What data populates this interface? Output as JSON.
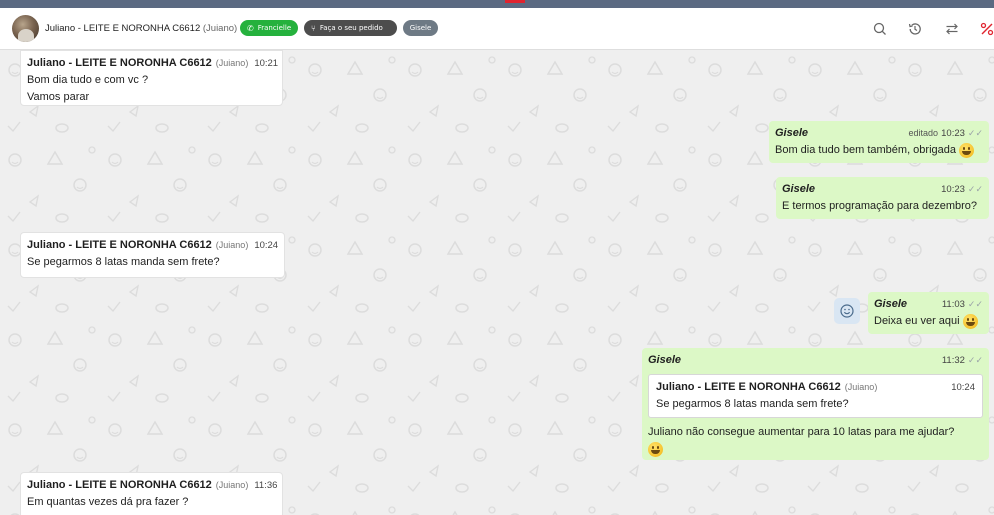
{
  "header": {
    "contact_name": "Juliano - LEITE E NORONHA C6612",
    "contact_alias": "(Juiano)",
    "chip_whatsapp": "Francielle",
    "chip_order": "Faça o seu pedido",
    "chip_agent": "Gisele",
    "icons": [
      "search-icon",
      "history-icon",
      "transfer-icon",
      "percent-icon"
    ]
  },
  "messages": [
    {
      "sender": "Juliano - LEITE E NORONHA C6612",
      "alias": "(Juiano)",
      "time": "10:21",
      "lines": [
        "Bom dia tudo e com vc ?",
        "Vamos parar"
      ]
    },
    {
      "sender": "Gisele",
      "edited": "editado",
      "time": "10:23",
      "text": "Bom dia tudo bem também, obrigada"
    },
    {
      "sender": "Gisele",
      "time": "10:23",
      "text": "E termos programação para dezembro?"
    },
    {
      "sender": "Juliano - LEITE E NORONHA C6612",
      "alias": "(Juiano)",
      "time": "10:24",
      "text": "Se pegarmos 8 latas manda sem frete?"
    },
    {
      "sender": "Gisele",
      "time": "11:03",
      "text": "Deixa eu ver aqui"
    },
    {
      "sender": "Gisele",
      "time": "11:32",
      "quote": {
        "sender": "Juliano - LEITE E NORONHA C6612",
        "alias": "(Juiano)",
        "time": "10:24",
        "text": "Se pegarmos 8 latas manda sem frete?"
      },
      "text": "Juliano não consegue aumentar para 10 latas para me ajudar?"
    },
    {
      "sender": "Juliano - LEITE E NORONHA C6612",
      "alias": "(Juiano)",
      "time": "11:36",
      "text": "Em quantas vezes dá pra fazer ?"
    }
  ],
  "colors": {
    "incoming": "#ffffff",
    "outgoing": "#dcf8c6",
    "chip_whatsapp": "#25b13d",
    "chip_order": "#4d4d4d",
    "chip_agent": "#6e7a85",
    "top_bar": "#5b6a82"
  }
}
